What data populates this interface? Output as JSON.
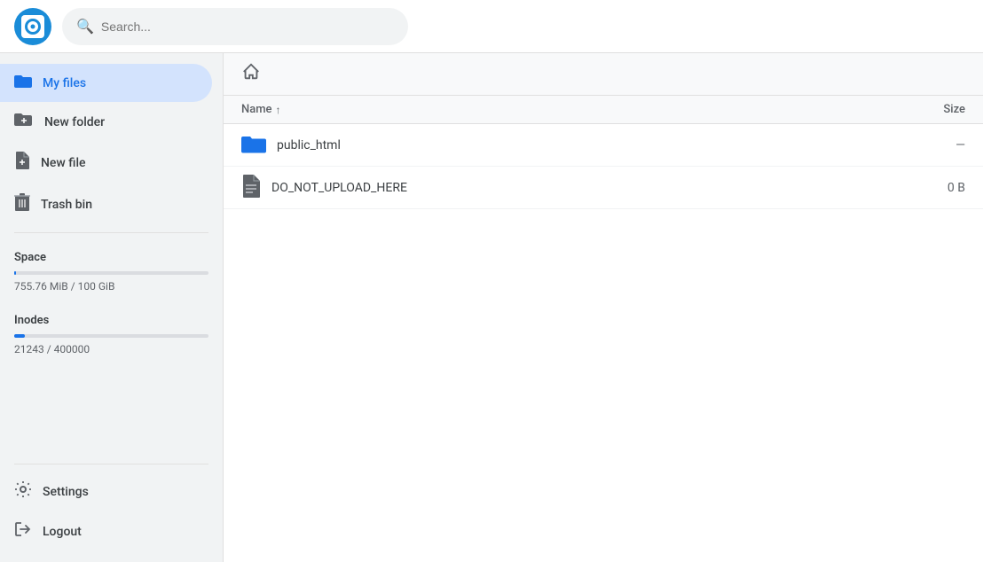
{
  "topbar": {
    "search_placeholder": "Search...",
    "logo_alt": "App logo"
  },
  "sidebar": {
    "items": [
      {
        "id": "my-files",
        "label": "My files",
        "icon": "folder",
        "active": true
      },
      {
        "id": "new-folder",
        "label": "New folder",
        "icon": "new-folder",
        "active": false
      },
      {
        "id": "new-file",
        "label": "New file",
        "icon": "new-file",
        "active": false
      },
      {
        "id": "trash-bin",
        "label": "Trash bin",
        "icon": "trash",
        "active": false
      }
    ],
    "space": {
      "label": "Space",
      "used": "755.76 MiB",
      "total": "100 GiB",
      "text": "755.76 MiB / 100 GiB",
      "percent": 0.74
    },
    "inodes": {
      "label": "Inodes",
      "used": 21243,
      "total": 400000,
      "text": "21243 / 400000",
      "percent": 5.31
    },
    "bottom_items": [
      {
        "id": "settings",
        "label": "Settings",
        "icon": "gear"
      },
      {
        "id": "logout",
        "label": "Logout",
        "icon": "logout"
      }
    ]
  },
  "main": {
    "breadcrumb": "home",
    "table": {
      "col_name": "Name",
      "col_size": "Size",
      "rows": [
        {
          "id": "row-1",
          "name": "public_html",
          "type": "folder",
          "size": "—"
        },
        {
          "id": "row-2",
          "name": "DO_NOT_UPLOAD_HERE",
          "type": "file",
          "size": "0 B"
        }
      ]
    }
  }
}
